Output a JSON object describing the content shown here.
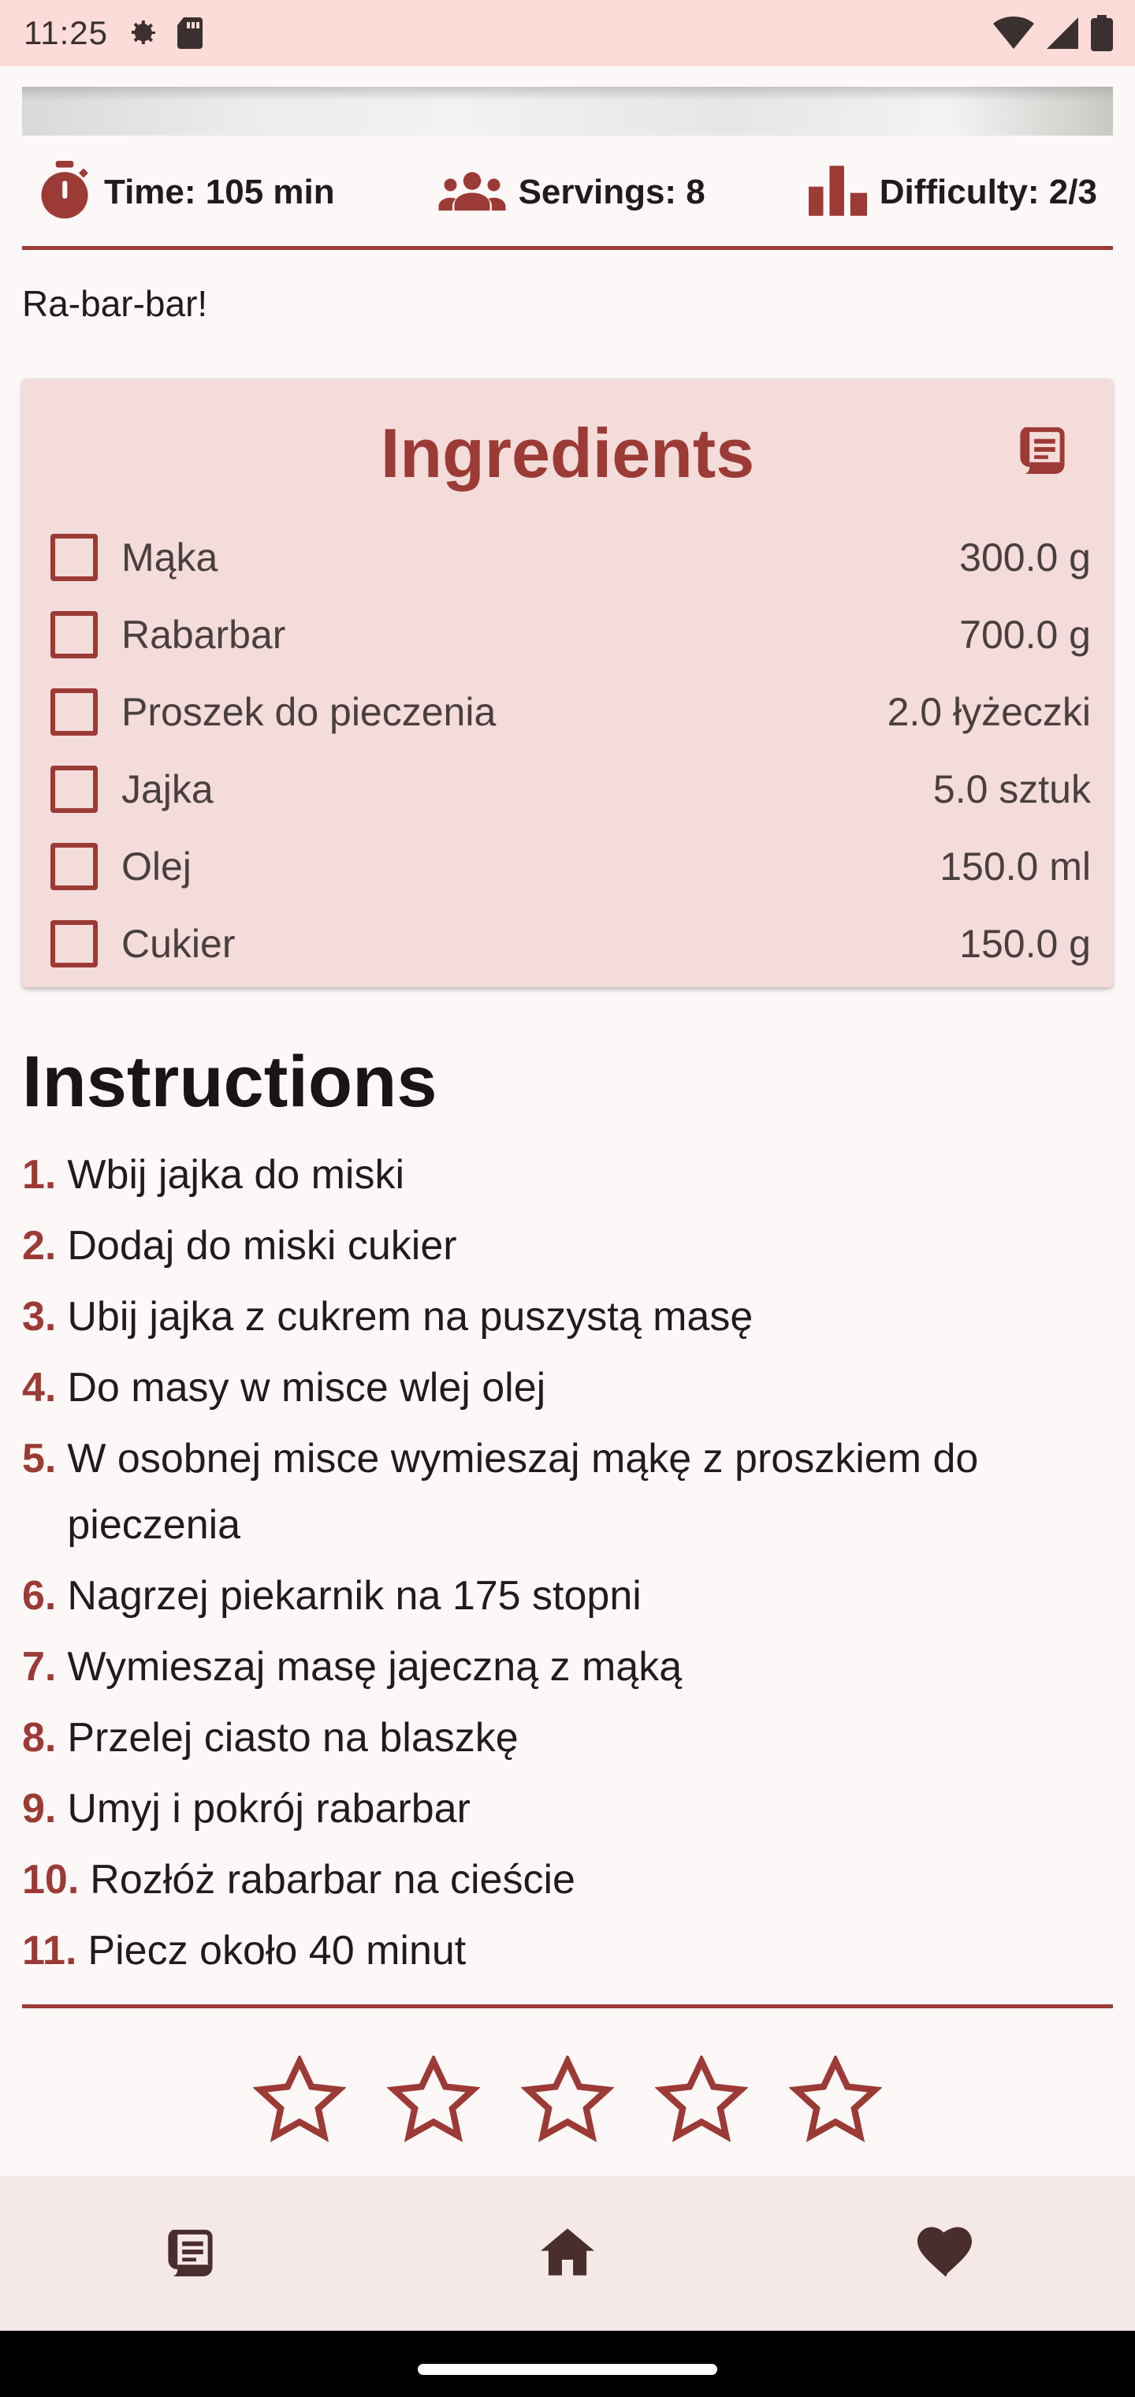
{
  "status_bar": {
    "time": "11:25",
    "left_icons": [
      "settings-gear-icon",
      "sd-card-icon"
    ],
    "right_icons": [
      "wifi-icon",
      "signal-icon",
      "battery-icon"
    ]
  },
  "stats": {
    "time_label": "Time: 105 min",
    "servings_label": "Servings: 8",
    "difficulty_label": "Difficulty: 2/3"
  },
  "description": "Ra-bar-bar!",
  "ingredients": {
    "title": "Ingredients",
    "items": [
      {
        "name": "Mąka",
        "amount": "300.0 g"
      },
      {
        "name": "Rabarbar",
        "amount": "700.0 g"
      },
      {
        "name": "Proszek do pieczenia",
        "amount": "2.0 łyżeczki"
      },
      {
        "name": "Jajka",
        "amount": "5.0 sztuk"
      },
      {
        "name": "Olej",
        "amount": "150.0 ml"
      },
      {
        "name": "Cukier",
        "amount": "150.0 g"
      }
    ]
  },
  "instructions": {
    "title": "Instructions",
    "steps": [
      {
        "num": "1.",
        "text": "Wbij jajka do miski"
      },
      {
        "num": "2.",
        "text": "Dodaj do miski cukier"
      },
      {
        "num": "3.",
        "text": "Ubij jajka z cukrem na puszystą masę"
      },
      {
        "num": "4.",
        "text": "Do masy w misce wlej olej"
      },
      {
        "num": "5.",
        "text": "W osobnej misce wymieszaj mąkę z proszkiem do pieczenia"
      },
      {
        "num": "6.",
        "text": "Nagrzej piekarnik na 175 stopni"
      },
      {
        "num": "7.",
        "text": "Wymieszaj masę jajeczną z mąką"
      },
      {
        "num": "8.",
        "text": "Przelej ciasto na blaszkę"
      },
      {
        "num": "9.",
        "text": "Umyj i pokrój rabarbar"
      },
      {
        "num": "10.",
        "text": "Rozłóż rabarbar na cieście"
      },
      {
        "num": "11.",
        "text": "Piecz około 40 minut"
      }
    ]
  },
  "rating": {
    "stars": 5,
    "selected": 0
  },
  "bottom_nav": {
    "items": [
      "recipes-icon",
      "home-icon",
      "favorites-heart-icon"
    ]
  },
  "colors": {
    "accent": "#9c3a36",
    "card_bg": "#f3dcda",
    "status_bar_bg": "#fbdcd9",
    "nav_bg": "#f5e9e8",
    "text_dark": "#231b1b",
    "icon_dark": "#4a2d2d"
  }
}
